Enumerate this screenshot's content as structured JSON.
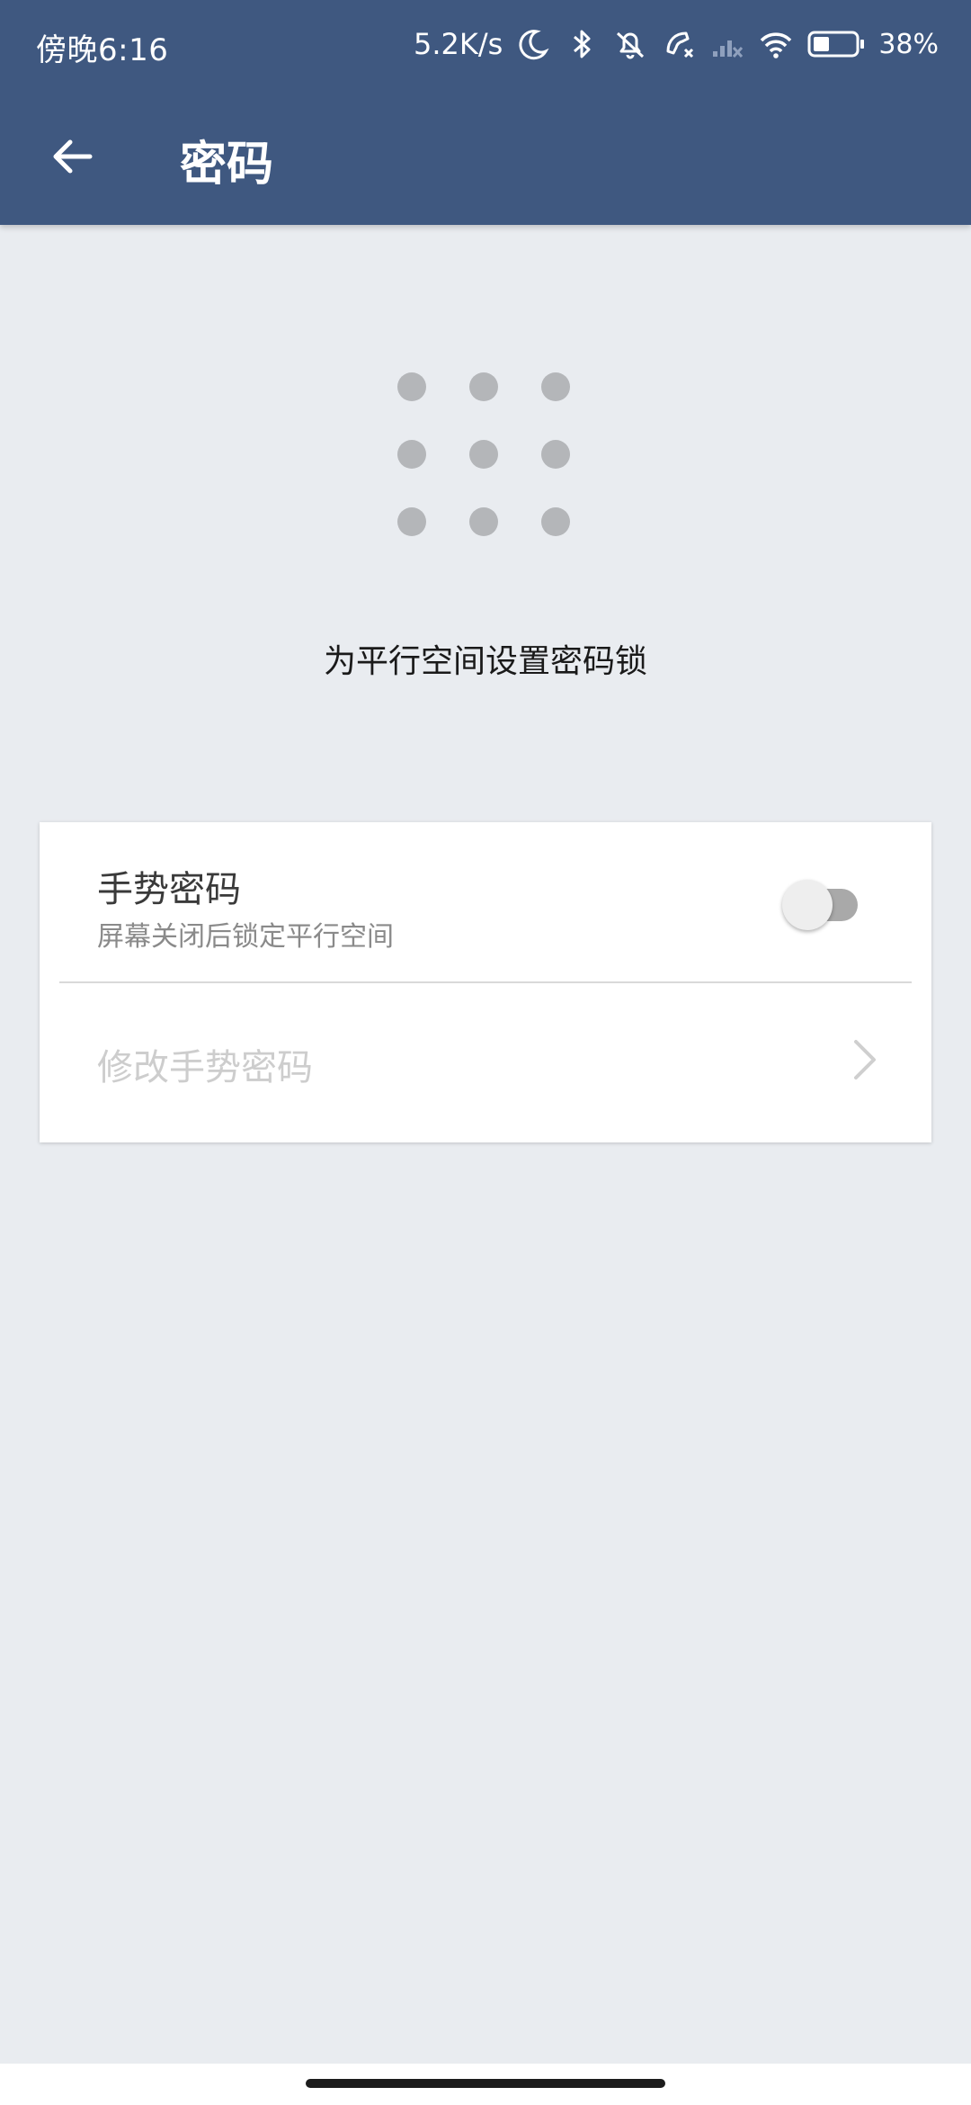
{
  "status_bar": {
    "time": "傍晚6:16",
    "net_speed": "5.2K/s",
    "battery_percent": "38%",
    "battery_level": 0.38,
    "icons": [
      "moon-icon",
      "bluetooth-icon",
      "bell-off-icon",
      "call-off-icon",
      "signal-off-icon",
      "wifi-icon",
      "battery-icon"
    ]
  },
  "app_bar": {
    "title": "密码",
    "back_icon": "arrow-left-icon"
  },
  "pattern": {
    "rows": 3,
    "cols": 3
  },
  "subtitle": "为平行空间设置密码锁",
  "settings": {
    "gesture": {
      "title": "手势密码",
      "subtitle": "屏幕关闭后锁定平行空间",
      "enabled": false
    },
    "modify": {
      "label": "修改手势密码",
      "chevron_icon": "chevron-right-icon"
    }
  },
  "colors": {
    "appbar": "#3f5880",
    "background": "#e9ecf0",
    "card": "#ffffff",
    "dot": "#b4b6b9",
    "disabled_text": "#cdcdcd"
  }
}
